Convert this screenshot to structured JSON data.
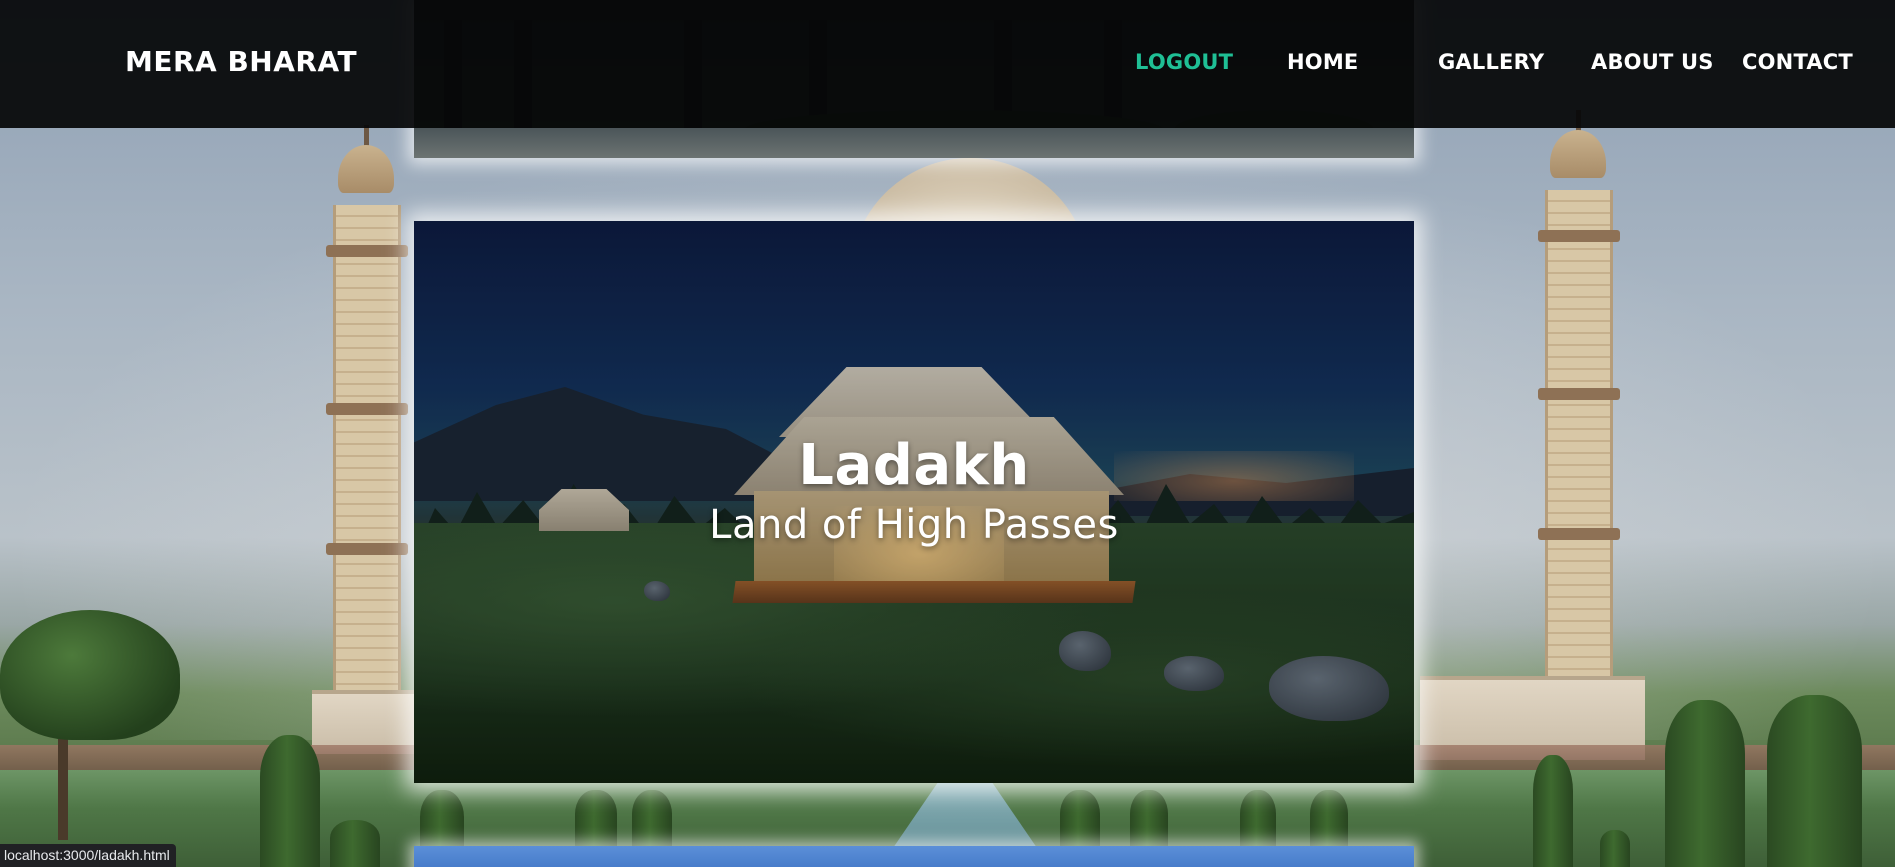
{
  "brand": "MERA BHARAT",
  "nav": {
    "logout": "LOGOUT",
    "home": "HOME",
    "gallery": "GALLERY",
    "about": "ABOUT US",
    "contact": "CONTACT"
  },
  "feature": {
    "title": "Ladakh",
    "subtitle": "Land of High Passes"
  },
  "status_url": "localhost:3000/ladakh.html",
  "colors": {
    "accent": "#1fbf95",
    "navbar": "#050608"
  }
}
